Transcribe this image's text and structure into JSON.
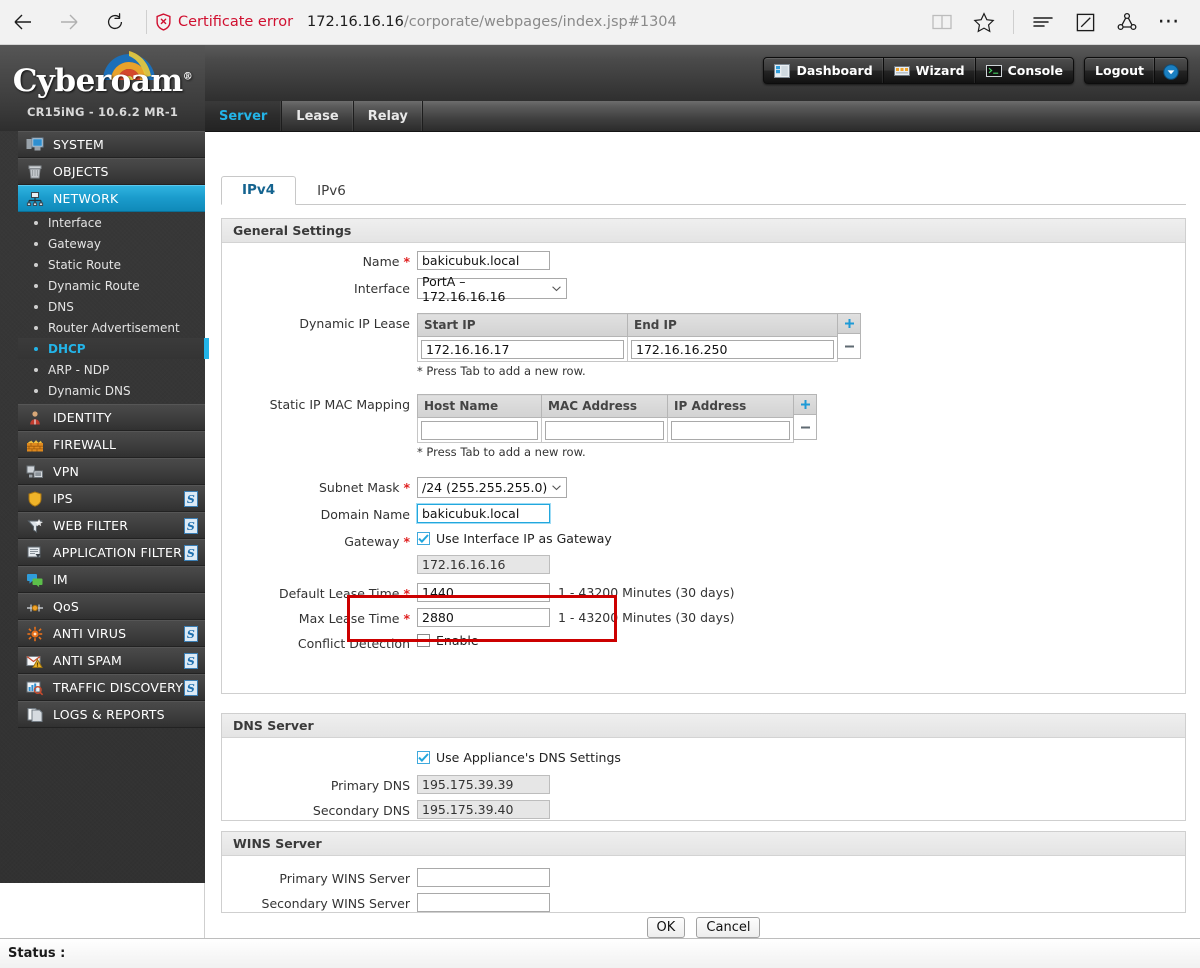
{
  "browser": {
    "back_icon": "back-arrow-icon",
    "forward_icon": "forward-arrow-icon",
    "refresh_icon": "refresh-icon",
    "certificate_error": "Certificate error",
    "url_host": "172.16.16.16",
    "url_path": "/corporate/webpages/index.jsp#1304",
    "reading_view_icon": "reading-view-icon",
    "favorites_icon": "star-icon",
    "hub_icon": "hub-icon",
    "web_note_icon": "web-note-icon",
    "share_icon": "share-icon",
    "more_icon": "more-icon"
  },
  "header": {
    "brand": "Cyberoam",
    "brand_mark": "®",
    "model": "CR15iNG - 10.6.2 MR-1",
    "buttons": [
      {
        "label": "Dashboard",
        "icon": "dashboard-icon"
      },
      {
        "label": "Wizard",
        "icon": "wizard-icon"
      },
      {
        "label": "Console",
        "icon": "console-icon"
      }
    ],
    "logout_label": "Logout",
    "logout_arrow_icon": "chevron-down-circle-icon"
  },
  "main_tabs": [
    {
      "label": "Server",
      "active": true
    },
    {
      "label": "Lease",
      "active": false
    },
    {
      "label": "Relay",
      "active": false
    }
  ],
  "sidebar": {
    "modules": [
      {
        "label": "SYSTEM",
        "icon": "system-monitor-icon",
        "active": false,
        "badge": false
      },
      {
        "label": "OBJECTS",
        "icon": "objects-box-icon",
        "active": false,
        "badge": false
      },
      {
        "label": "NETWORK",
        "icon": "network-icon",
        "active": true,
        "badge": false
      },
      {
        "label": "IDENTITY",
        "icon": "identity-user-icon",
        "active": false,
        "badge": false
      },
      {
        "label": "FIREWALL",
        "icon": "firewall-icon",
        "active": false,
        "badge": false
      },
      {
        "label": "VPN",
        "icon": "vpn-icon",
        "active": false,
        "badge": false
      },
      {
        "label": "IPS",
        "icon": "ips-shield-icon",
        "active": false,
        "badge": true
      },
      {
        "label": "WEB FILTER",
        "icon": "web-filter-funnel-icon",
        "active": false,
        "badge": true
      },
      {
        "label": "APPLICATION FILTER",
        "icon": "application-filter-icon",
        "active": false,
        "badge": true
      },
      {
        "label": "IM",
        "icon": "im-chat-icon",
        "active": false,
        "badge": false
      },
      {
        "label": "QoS",
        "icon": "qos-icon",
        "active": false,
        "badge": false
      },
      {
        "label": "ANTI VIRUS",
        "icon": "anti-virus-icon",
        "active": false,
        "badge": true
      },
      {
        "label": "ANTI SPAM",
        "icon": "anti-spam-icon",
        "active": false,
        "badge": true
      },
      {
        "label": "TRAFFIC DISCOVERY",
        "icon": "traffic-discovery-icon",
        "active": false,
        "badge": true
      },
      {
        "label": "LOGS & REPORTS",
        "icon": "logs-reports-icon",
        "active": false,
        "badge": false
      }
    ],
    "network_submenu": [
      {
        "label": "Interface",
        "active": false
      },
      {
        "label": "Gateway",
        "active": false
      },
      {
        "label": "Static Route",
        "active": false
      },
      {
        "label": "Dynamic Route",
        "active": false
      },
      {
        "label": "DNS",
        "active": false
      },
      {
        "label": "Router Advertisement",
        "active": false
      },
      {
        "label": "DHCP",
        "active": true
      },
      {
        "label": "ARP - NDP",
        "active": false
      },
      {
        "label": "Dynamic DNS",
        "active": false
      }
    ]
  },
  "sub_tabs": [
    {
      "label": "IPv4",
      "active": true
    },
    {
      "label": "IPv6",
      "active": false
    }
  ],
  "general_settings": {
    "title": "General Settings",
    "name_label": "Name",
    "name_value": "bakicubuk.local",
    "interface_label": "Interface",
    "interface_value": "PortA – 172.16.16.16",
    "dynamic_ip_lease_label": "Dynamic IP Lease",
    "dynamic_ip_lease_columns": [
      "Start IP",
      "End IP"
    ],
    "dynamic_ip_lease_rows": [
      [
        "172.16.16.17",
        "172.16.16.250"
      ]
    ],
    "dynamic_ip_lease_note": "* Press Tab to add a new row.",
    "static_mapping_label": "Static IP MAC Mapping",
    "static_mapping_columns": [
      "Host Name",
      "MAC Address",
      "IP Address"
    ],
    "static_mapping_rows": [
      [
        "",
        "",
        ""
      ]
    ],
    "static_mapping_note": "* Press Tab to add a new row.",
    "subnet_mask_label": "Subnet Mask",
    "subnet_mask_value": "/24 (255.255.255.0)",
    "domain_name_label": "Domain Name",
    "domain_name_value": "bakicubuk.local",
    "gateway_label": "Gateway",
    "gateway_checkbox_label": "Use Interface IP as Gateway",
    "gateway_checkbox_checked": true,
    "gateway_value": "172.16.16.16",
    "default_lease_label": "Default Lease Time",
    "default_lease_value": "1440",
    "default_lease_hint": "1 - 43200 Minutes (30 days)",
    "max_lease_label": "Max Lease Time",
    "max_lease_value": "2880",
    "max_lease_hint": "1 - 43200 Minutes (30 days)",
    "conflict_detection_label": "Conflict Detection",
    "conflict_detection_checkbox_label": "Enable",
    "conflict_detection_checked": false,
    "add_row_icon": "plus-icon",
    "remove_row_icon": "minus-icon",
    "highlight_color": "#cc0000"
  },
  "dns_server": {
    "title": "DNS Server",
    "use_appliance_label": "Use Appliance's DNS Settings",
    "use_appliance_checked": true,
    "primary_label": "Primary DNS",
    "primary_value": "195.175.39.39",
    "secondary_label": "Secondary DNS",
    "secondary_value": "195.175.39.40"
  },
  "wins_server": {
    "title": "WINS Server",
    "primary_label": "Primary WINS Server",
    "primary_value": "",
    "secondary_label": "Secondary WINS Server",
    "secondary_value": ""
  },
  "actions": {
    "ok_label": "OK",
    "cancel_label": "Cancel"
  },
  "statusbar": {
    "label": "Status :"
  }
}
